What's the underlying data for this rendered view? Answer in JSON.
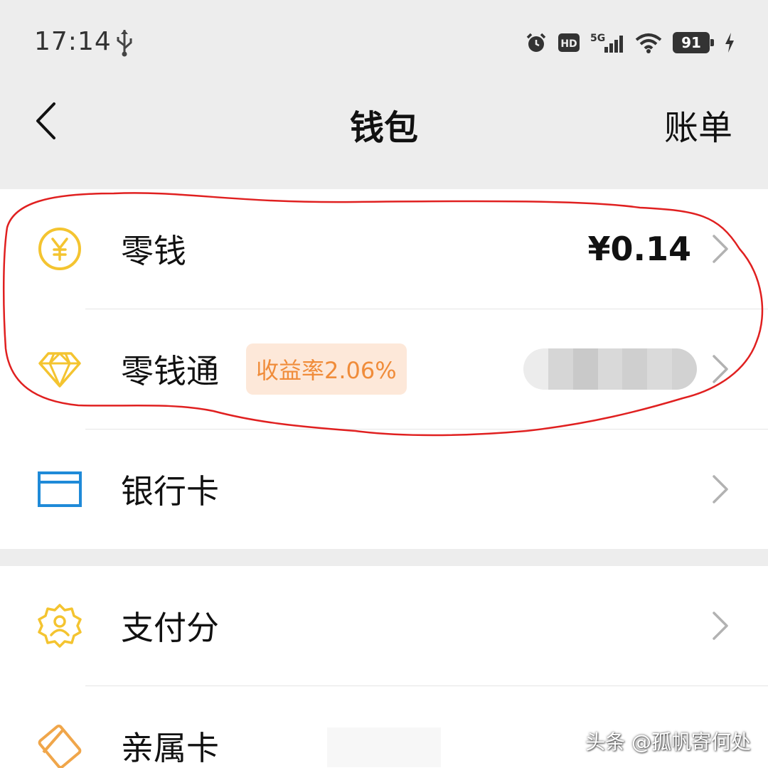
{
  "status_bar": {
    "time": "17:14",
    "icons": [
      "usb-icon",
      "alarm-icon",
      "hd-icon",
      "signal-5g-icon",
      "wifi-icon",
      "battery-icon",
      "charging-icon"
    ],
    "hd_label": "HD",
    "network_label": "5G",
    "battery_level": "91"
  },
  "nav": {
    "back_icon": "chevron-left-icon",
    "title": "钱包",
    "right_action": "账单"
  },
  "wallet_items": [
    {
      "label": "零钱",
      "icon": "yuan-coin-icon",
      "value": "¥0.14"
    },
    {
      "label": "零钱通",
      "icon": "diamond-icon",
      "badge": "收益率2.06%"
    },
    {
      "label": "银行卡",
      "icon": "bank-card-icon"
    }
  ],
  "service_items": [
    {
      "label": "支付分",
      "icon": "credit-score-badge-icon"
    },
    {
      "label": "亲属卡",
      "icon": "family-card-icon"
    }
  ],
  "colors": {
    "background": "#ededed",
    "accent_yellow": "#f4c430",
    "card_blue": "#1f8ad8",
    "badge_bg": "#fde8d9",
    "badge_text": "#f08c3a",
    "annotation_red": "#e02020"
  },
  "watermark": "头条 @孤帆寄何处"
}
